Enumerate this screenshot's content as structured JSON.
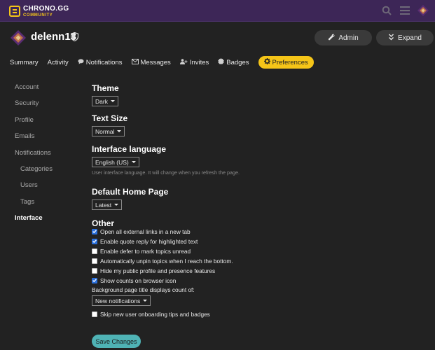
{
  "topbar": {
    "logo_main": "CHRONO.GG",
    "logo_sub": "COMMUNITY",
    "icons": [
      "search-icon",
      "menu-icon",
      "avatar"
    ]
  },
  "user": {
    "username": "delenn13",
    "buttons": {
      "admin": "Admin",
      "expand": "Expand"
    }
  },
  "tabs": [
    {
      "label": "Summary",
      "icon": "",
      "active": false
    },
    {
      "label": "Activity",
      "icon": "",
      "active": false
    },
    {
      "label": "Notifications",
      "icon": "speech-bubble-icon",
      "active": false
    },
    {
      "label": "Messages",
      "icon": "envelope-icon",
      "active": false
    },
    {
      "label": "Invites",
      "icon": "user-plus-icon",
      "active": false
    },
    {
      "label": "Badges",
      "icon": "certificate-icon",
      "active": false
    },
    {
      "label": "Preferences",
      "icon": "gear-icon",
      "active": true
    }
  ],
  "sidebar": {
    "items": [
      {
        "label": "Account",
        "sub": false,
        "active": false
      },
      {
        "label": "Security",
        "sub": false,
        "active": false
      },
      {
        "label": "Profile",
        "sub": false,
        "active": false
      },
      {
        "label": "Emails",
        "sub": false,
        "active": false
      },
      {
        "label": "Notifications",
        "sub": false,
        "active": false
      },
      {
        "label": "Categories",
        "sub": true,
        "active": false
      },
      {
        "label": "Users",
        "sub": true,
        "active": false
      },
      {
        "label": "Tags",
        "sub": true,
        "active": false
      },
      {
        "label": "Interface",
        "sub": false,
        "active": true
      }
    ]
  },
  "interface": {
    "theme": {
      "title": "Theme",
      "value": "Dark"
    },
    "text_size": {
      "title": "Text Size",
      "value": "Normal"
    },
    "language": {
      "title": "Interface language",
      "value": "English (US)",
      "help": "User interface language. It will change when you refresh the page."
    },
    "home_page": {
      "title": "Default Home Page",
      "value": "Latest"
    },
    "other": {
      "title": "Other",
      "options": [
        {
          "label": "Open all external links in a new tab",
          "checked": true
        },
        {
          "label": "Enable quote reply for highlighted text",
          "checked": true
        },
        {
          "label": "Enable defer to mark topics unread",
          "checked": false
        },
        {
          "label": "Automatically unpin topics when I reach the bottom.",
          "checked": false
        },
        {
          "label": "Hide my public profile and presence features",
          "checked": false
        },
        {
          "label": "Show counts on browser icon",
          "checked": true
        }
      ],
      "bg_title_label": "Background page title displays count of:",
      "bg_title_value": "New notifications",
      "skip_onboarding": {
        "label": "Skip new user onboarding tips and badges",
        "checked": false
      }
    },
    "save_label": "Save Changes"
  },
  "colors": {
    "topbar": "#3d2657",
    "accent": "#f5c518",
    "save_button": "#4fb3b5",
    "checkbox_checked": "#2a6fdb",
    "background": "#222222"
  }
}
